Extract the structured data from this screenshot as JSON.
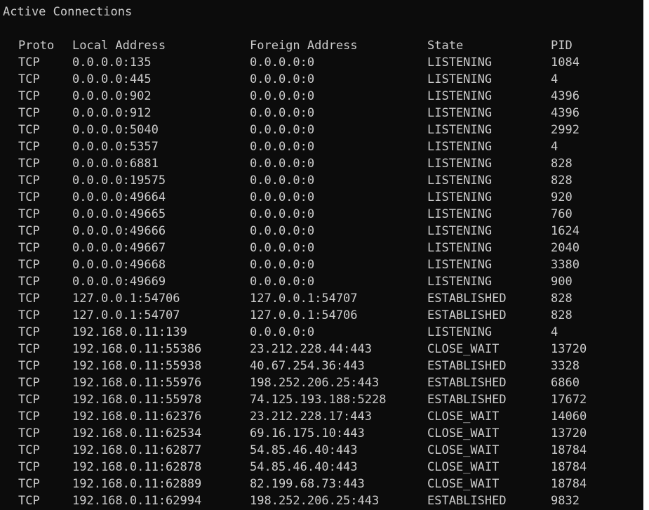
{
  "window": {
    "title": "Active Connections"
  },
  "table": {
    "columns": {
      "proto": "Proto",
      "local": "Local Address",
      "foreign": "Foreign Address",
      "state": "State",
      "pid": "PID"
    },
    "rows": [
      {
        "proto": "TCP",
        "local": "0.0.0.0:135",
        "foreign": "0.0.0.0:0",
        "state": "LISTENING",
        "pid": "1084"
      },
      {
        "proto": "TCP",
        "local": "0.0.0.0:445",
        "foreign": "0.0.0.0:0",
        "state": "LISTENING",
        "pid": "4"
      },
      {
        "proto": "TCP",
        "local": "0.0.0.0:902",
        "foreign": "0.0.0.0:0",
        "state": "LISTENING",
        "pid": "4396"
      },
      {
        "proto": "TCP",
        "local": "0.0.0.0:912",
        "foreign": "0.0.0.0:0",
        "state": "LISTENING",
        "pid": "4396"
      },
      {
        "proto": "TCP",
        "local": "0.0.0.0:5040",
        "foreign": "0.0.0.0:0",
        "state": "LISTENING",
        "pid": "2992"
      },
      {
        "proto": "TCP",
        "local": "0.0.0.0:5357",
        "foreign": "0.0.0.0:0",
        "state": "LISTENING",
        "pid": "4"
      },
      {
        "proto": "TCP",
        "local": "0.0.0.0:6881",
        "foreign": "0.0.0.0:0",
        "state": "LISTENING",
        "pid": "828"
      },
      {
        "proto": "TCP",
        "local": "0.0.0.0:19575",
        "foreign": "0.0.0.0:0",
        "state": "LISTENING",
        "pid": "828"
      },
      {
        "proto": "TCP",
        "local": "0.0.0.0:49664",
        "foreign": "0.0.0.0:0",
        "state": "LISTENING",
        "pid": "920"
      },
      {
        "proto": "TCP",
        "local": "0.0.0.0:49665",
        "foreign": "0.0.0.0:0",
        "state": "LISTENING",
        "pid": "760"
      },
      {
        "proto": "TCP",
        "local": "0.0.0.0:49666",
        "foreign": "0.0.0.0:0",
        "state": "LISTENING",
        "pid": "1624"
      },
      {
        "proto": "TCP",
        "local": "0.0.0.0:49667",
        "foreign": "0.0.0.0:0",
        "state": "LISTENING",
        "pid": "2040"
      },
      {
        "proto": "TCP",
        "local": "0.0.0.0:49668",
        "foreign": "0.0.0.0:0",
        "state": "LISTENING",
        "pid": "3380"
      },
      {
        "proto": "TCP",
        "local": "0.0.0.0:49669",
        "foreign": "0.0.0.0:0",
        "state": "LISTENING",
        "pid": "900"
      },
      {
        "proto": "TCP",
        "local": "127.0.0.1:54706",
        "foreign": "127.0.0.1:54707",
        "state": "ESTABLISHED",
        "pid": "828"
      },
      {
        "proto": "TCP",
        "local": "127.0.0.1:54707",
        "foreign": "127.0.0.1:54706",
        "state": "ESTABLISHED",
        "pid": "828"
      },
      {
        "proto": "TCP",
        "local": "192.168.0.11:139",
        "foreign": "0.0.0.0:0",
        "state": "LISTENING",
        "pid": "4"
      },
      {
        "proto": "TCP",
        "local": "192.168.0.11:55386",
        "foreign": "23.212.228.44:443",
        "state": "CLOSE_WAIT",
        "pid": "13720"
      },
      {
        "proto": "TCP",
        "local": "192.168.0.11:55938",
        "foreign": "40.67.254.36:443",
        "state": "ESTABLISHED",
        "pid": "3328"
      },
      {
        "proto": "TCP",
        "local": "192.168.0.11:55976",
        "foreign": "198.252.206.25:443",
        "state": "ESTABLISHED",
        "pid": "6860"
      },
      {
        "proto": "TCP",
        "local": "192.168.0.11:55978",
        "foreign": "74.125.193.188:5228",
        "state": "ESTABLISHED",
        "pid": "17672"
      },
      {
        "proto": "TCP",
        "local": "192.168.0.11:62376",
        "foreign": "23.212.228.17:443",
        "state": "CLOSE_WAIT",
        "pid": "14060"
      },
      {
        "proto": "TCP",
        "local": "192.168.0.11:62534",
        "foreign": "69.16.175.10:443",
        "state": "CLOSE_WAIT",
        "pid": "13720"
      },
      {
        "proto": "TCP",
        "local": "192.168.0.11:62877",
        "foreign": "54.85.46.40:443",
        "state": "CLOSE_WAIT",
        "pid": "18784"
      },
      {
        "proto": "TCP",
        "local": "192.168.0.11:62878",
        "foreign": "54.85.46.40:443",
        "state": "CLOSE_WAIT",
        "pid": "18784"
      },
      {
        "proto": "TCP",
        "local": "192.168.0.11:62889",
        "foreign": "82.199.68.73:443",
        "state": "CLOSE_WAIT",
        "pid": "18784"
      },
      {
        "proto": "TCP",
        "local": "192.168.0.11:62994",
        "foreign": "198.252.206.25:443",
        "state": "ESTABLISHED",
        "pid": "9832"
      }
    ]
  },
  "colors": {
    "background": "#0c0c0c",
    "text": "#cccccc"
  }
}
